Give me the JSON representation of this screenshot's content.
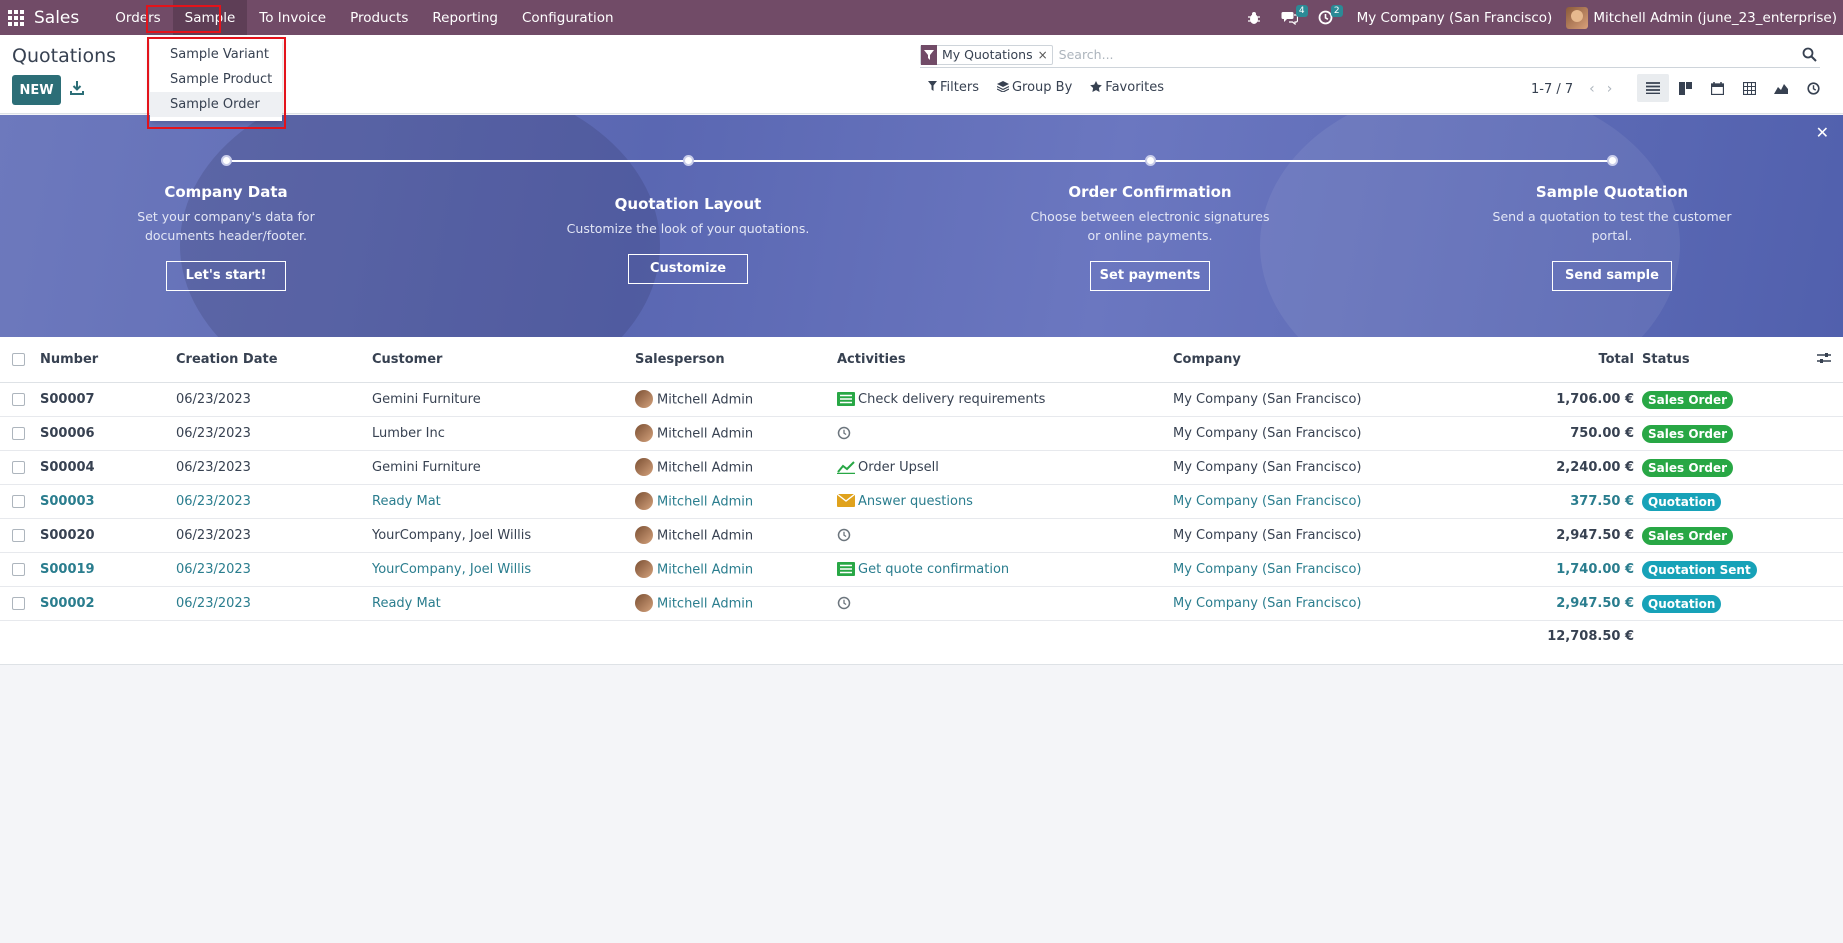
{
  "navbar": {
    "brand": "Sales",
    "menu": [
      "Orders",
      "Sample",
      "To Invoice",
      "Products",
      "Reporting",
      "Configuration"
    ],
    "messages_count": "4",
    "activities_count": "2",
    "company": "My Company (San Francisco)",
    "user": "Mitchell Admin (june_23_enterprise)",
    "bar_color": "#714b67"
  },
  "dropdown": {
    "items": [
      "Sample Variant",
      "Sample Product",
      "Sample Order"
    ],
    "hovered": "Sample Order"
  },
  "control": {
    "title": "Quotations",
    "new_label": "NEW",
    "facet": "My Quotations",
    "search_placeholder": "Search...",
    "filters_label": "Filters",
    "groupby_label": "Group By",
    "favorites_label": "Favorites",
    "pager": "1-7 / 7"
  },
  "banner": {
    "steps": [
      {
        "title": "Company Data",
        "desc": "Set your company's data for documents header/footer.",
        "button": "Let's start!"
      },
      {
        "title": "Quotation Layout",
        "desc": "Customize the look of your quotations.",
        "button": "Customize"
      },
      {
        "title": "Order Confirmation",
        "desc": "Choose between electronic signatures or online payments.",
        "button": "Set payments"
      },
      {
        "title": "Sample Quotation",
        "desc": "Send a quotation to test the customer portal.",
        "button": "Send sample"
      }
    ]
  },
  "table": {
    "columns": [
      "Number",
      "Creation Date",
      "Customer",
      "Salesperson",
      "Activities",
      "Company",
      "Total",
      "Status"
    ],
    "rows": [
      {
        "number": "S00007",
        "date": "06/23/2023",
        "customer": "Gemini Furniture",
        "salesperson": "Mitchell Admin",
        "activity": "Check delivery requirements",
        "activity_icon": "list-icon",
        "company": "My Company (San Francisco)",
        "total": "1,706.00 €",
        "status": "Sales Order",
        "style": "dark"
      },
      {
        "number": "S00006",
        "date": "06/23/2023",
        "customer": "Lumber Inc",
        "salesperson": "Mitchell Admin",
        "activity": "",
        "activity_icon": "clock-icon",
        "company": "My Company (San Francisco)",
        "total": "750.00 €",
        "status": "Sales Order",
        "style": "dark"
      },
      {
        "number": "S00004",
        "date": "06/23/2023",
        "customer": "Gemini Furniture",
        "salesperson": "Mitchell Admin",
        "activity": "Order Upsell",
        "activity_icon": "chart-icon",
        "company": "My Company (San Francisco)",
        "total": "2,240.00 €",
        "status": "Sales Order",
        "style": "dark"
      },
      {
        "number": "S00003",
        "date": "06/23/2023",
        "customer": "Ready Mat",
        "salesperson": "Mitchell Admin",
        "activity": "Answer questions",
        "activity_icon": "envelope-icon",
        "company": "My Company (San Francisco)",
        "total": "377.50 €",
        "status": "Quotation",
        "style": "teal"
      },
      {
        "number": "S00020",
        "date": "06/23/2023",
        "customer": "YourCompany, Joel Willis",
        "salesperson": "Mitchell Admin",
        "activity": "",
        "activity_icon": "clock-icon",
        "company": "My Company (San Francisco)",
        "total": "2,947.50 €",
        "status": "Sales Order",
        "style": "dark"
      },
      {
        "number": "S00019",
        "date": "06/23/2023",
        "customer": "YourCompany, Joel Willis",
        "salesperson": "Mitchell Admin",
        "activity": "Get quote confirmation",
        "activity_icon": "list-icon",
        "company": "My Company (San Francisco)",
        "total": "1,740.00 €",
        "status": "Quotation Sent",
        "style": "teal"
      },
      {
        "number": "S00002",
        "date": "06/23/2023",
        "customer": "Ready Mat",
        "salesperson": "Mitchell Admin",
        "activity": "",
        "activity_icon": "clock-icon",
        "company": "My Company (San Francisco)",
        "total": "2,947.50 €",
        "status": "Quotation",
        "style": "teal"
      }
    ],
    "grand_total": "12,708.50 €",
    "status_colors": {
      "Sales Order": "#28a745",
      "Quotation": "#17a2b8",
      "Quotation Sent": "#17a2b8"
    }
  }
}
